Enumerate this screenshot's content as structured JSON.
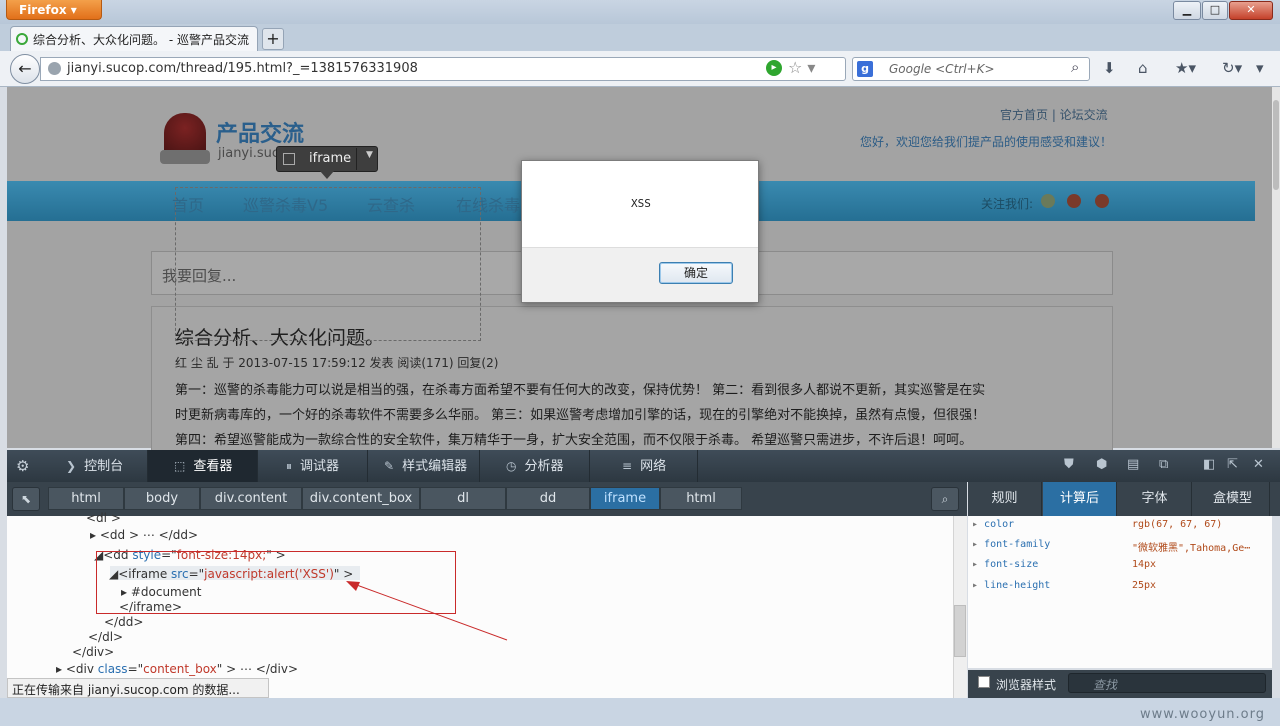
{
  "window": {
    "app_button": "Firefox",
    "tab_title": "综合分析、大众化问题。 - 巡警产品交流",
    "new_tab": "+"
  },
  "nav": {
    "url": "jianyi.sucop.com/thread/195.html?_=1381576331908",
    "search_placeholder": "Google <Ctrl+K>"
  },
  "page": {
    "site_title": "产品交流",
    "site_sub": "jianyi.suc",
    "top_links": "官方首页 | 论坛交流",
    "welcome": "您好，欢迎您给我们提产品的使用感受和建议！",
    "menu": [
      "首页",
      "巡警杀毒V5",
      "云查杀",
      "在线杀毒"
    ],
    "follow": "关注我们:",
    "reply_placeholder": "我要回复...",
    "post_title": "综合分析、大众化问题。",
    "post_meta": "红 尘 乱 于 2013-07-15 17:59:12 发表 阅读(171) 回复(2)",
    "post_lines": [
      "第一：巡警的杀毒能力可以说是相当的强，在杀毒方面希望不要有任何大的改变，保持优势！ 第二：看到很多人都说不更新，其实巡警是在实",
      "时更新病毒库的，一个好的杀毒软件不需要多么华丽。 第三：如果巡警考虑增加引擎的话，现在的引擎绝对不能换掉，虽然有点慢，但很强！",
      "第四：希望巡警能成为一款综合性的安全软件，集万精华于一身，扩大安全范围，而不仅限于杀毒。 希望巡警只需进步，不许后退！呵呵。"
    ],
    "tooltip": "iframe"
  },
  "dialog": {
    "message": "XSS",
    "ok": "确定"
  },
  "devtools": {
    "tabs": [
      "控制台",
      "查看器",
      "调试器",
      "样式编辑器",
      "分析器",
      "网络"
    ],
    "crumbs": [
      "html",
      "body",
      "div.content",
      "div.content_box",
      "dl",
      "dd",
      "iframe",
      "html"
    ],
    "side_tabs": [
      "规则",
      "计算后",
      "字体",
      "盒模型"
    ],
    "markup": {
      "l0": "<dl >",
      "l1": "<dd > ⋯ </dd>",
      "l2a": "<dd ",
      "l2b": "style",
      "l2c": "=\"",
      "l2d": "font-size:14px;",
      "l2e": "\" >",
      "l3a": "<iframe ",
      "l3b": "src",
      "l3c": "=\"",
      "l3d": "javascript:alert('XSS')",
      "l3e": "\" >",
      "l4": "#document",
      "l5": "</iframe>",
      "l6": "</dd>",
      "l7": "</dl>",
      "l8": "</div>",
      "l9a": "<div ",
      "l9b": "class",
      "l9c": "=\"",
      "l9d": "content_box",
      "l9e": "\" > ⋯ </div>"
    },
    "computed": [
      {
        "name": "color",
        "value": "rgb(67, 67, 67)"
      },
      {
        "name": "font-family",
        "value": "\"微软雅黑\",Tahoma,Ge⋯"
      },
      {
        "name": "font-size",
        "value": "14px"
      },
      {
        "name": "line-height",
        "value": "25px"
      }
    ],
    "browser_styles": "浏览器样式",
    "filter_placeholder": "查找"
  },
  "status": "正在传输来自 jianyi.sucop.com 的数据...",
  "watermark": "www.wooyun.org"
}
